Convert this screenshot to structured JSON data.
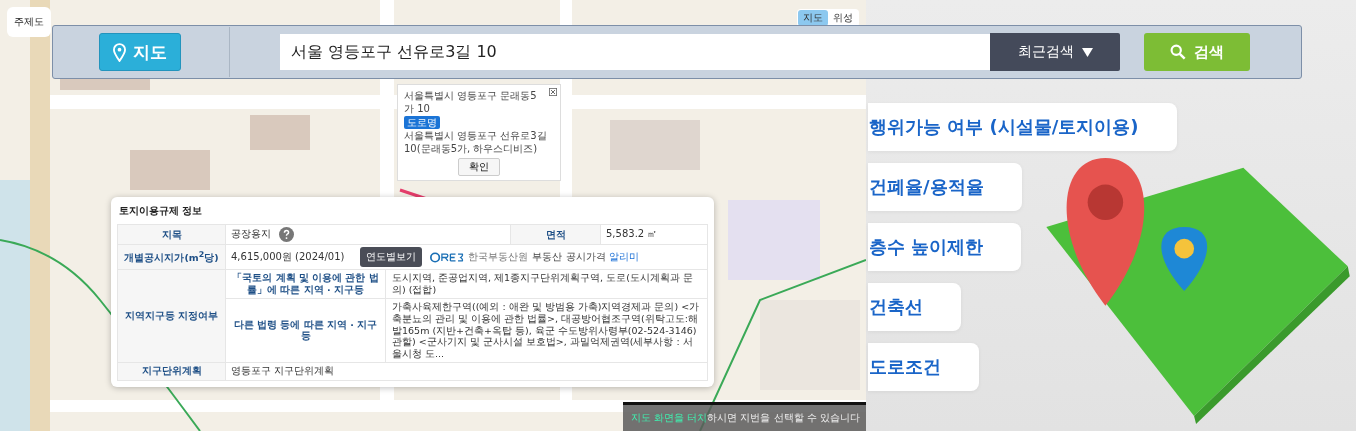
{
  "map_controls": {
    "theme_button": "주제도",
    "map_types": [
      {
        "label": "지도",
        "selected": true
      },
      {
        "label": "위성",
        "selected": false
      }
    ]
  },
  "search_bar": {
    "mode_button": "지도",
    "query": "서울 영등포구 선유로3길 10",
    "recent_button": "최근검색",
    "search_button": "검색"
  },
  "popup": {
    "jibun_address": "서울특별시 영등포구 문래동5가 10",
    "road_badge": "도로명",
    "road_address": "서울특별시 영등포구 선유로3길 10(문래동5가, 하우스디비즈)",
    "confirm_button": "확인"
  },
  "land_info": {
    "title": "토지이용규제 정보",
    "land_category": {
      "label": "지목",
      "value": "공장용지"
    },
    "area": {
      "label": "면적",
      "value": "5,583.2 ㎡"
    },
    "price": {
      "label": "개별공시지가(m$^{2}$당)",
      "value": "4,615,000원 (2024/01)",
      "year_button": "연도별보기",
      "provider": "한국부동산원",
      "link_text": "부동산 공시가격",
      "link_highlight": "알리미"
    },
    "zoning": {
      "label": "지역지구등 지정여부",
      "items": [
        {
          "law": "「국토의 계획 및 이용에 관한 법률」에 따른 지역 · 지구등",
          "content": "도시지역, 준공업지역, 제1종지구단위계획구역, 도로(도시계획과 문의) (접합)"
        },
        {
          "law": "다른 법령 등에 따른 지역 · 지구등",
          "content": "가축사육제한구역((예외 : 애완 및 방범용 가축)지역경제과 문의) <가축분뇨의 관리 및 이용에 관한 법률>, 대공방어협조구역(위탁고도:해발165m (지반+건축+옥탑 등), 육군 수도방위사령부(02-524-3146)관할) <군사기지 및 군사시설 보호법>, 과밀억제권역(세부사항 : 서울시청 도..."
        }
      ]
    },
    "district_plan": {
      "label": "지구단위계획",
      "value": "영등포구 지구단위계획"
    }
  },
  "toast": {
    "highlight": "지도 화면을 터치",
    "text": "하시면 지번을 선택할 수 있습니다"
  },
  "menu": [
    {
      "label": "행위가능 여부 (시설물/토지이용)"
    },
    {
      "label": "건폐율/용적율"
    },
    {
      "label": "층수 높이제한"
    },
    {
      "label": "건축선"
    },
    {
      "label": "도로조건"
    }
  ]
}
